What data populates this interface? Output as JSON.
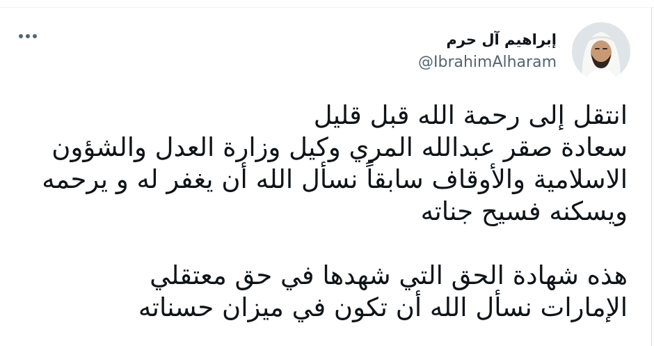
{
  "author": {
    "display_name": "إبراهيم آل حرم",
    "handle": "@IbrahimAlharam",
    "avatar_icon": "profile-photo-avatar"
  },
  "menu": {
    "icon": "more-horizontal-icon"
  },
  "tweet": {
    "paragraph1": [
      "انتقل إلى رحمة الله قبل قليل",
      "سعادة صقر عبدالله المري وكيل وزارة العدل والشؤون",
      "الاسلامية والأوقاف سابقاً نسأل الله أن يغفر له و يرحمه",
      "ويسكنه فسيح جناته"
    ],
    "paragraph2": [
      "هذه شهادة الحق التي شهدها في حق معتقلي",
      "الإمارات نسأل الله أن تكون في ميزان حسناته"
    ]
  },
  "colors": {
    "text_primary": "#0f1419",
    "text_secondary": "#536471",
    "divider": "#eff3f4"
  }
}
